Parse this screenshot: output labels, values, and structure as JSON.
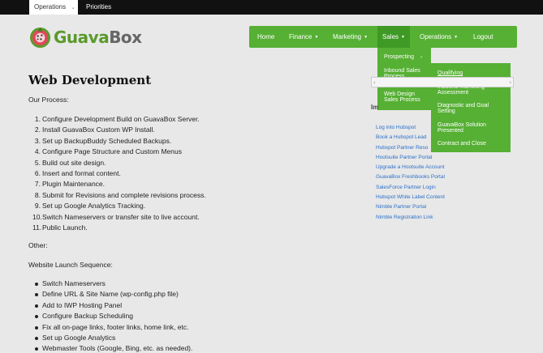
{
  "topbar": {
    "tabs": [
      {
        "label": "Operations"
      },
      {
        "label": "Priorities"
      }
    ]
  },
  "logo": {
    "part1": "Guava",
    "part2": "Box"
  },
  "nav": {
    "items": [
      "Home",
      "Finance",
      "Marketing",
      "Sales",
      "Operations",
      "Logout"
    ]
  },
  "sales_dropdown": {
    "items": [
      "Prospecting",
      "Inbound Sales Process Overview",
      "Web Design Sales Process"
    ]
  },
  "prospecting_submenu": {
    "items": [
      "Qualifying",
      "Inbound Marketing Assessment",
      "Diagnostic and Goal Setting",
      "GuavaBox Solution Presented",
      "Contract and Close"
    ]
  },
  "page": {
    "title": "Web Development",
    "our_process": "Our Process:",
    "steps": [
      "Configure Development Build on GuavaBox Server.",
      "Install GuavaBox Custom WP Install.",
      "Set up BackupBuddy Scheduled Backups.",
      "Configure Page Structure and Custom Menus",
      "Build out site design.",
      "Insert and format content.",
      "Plugin Maintenance.",
      "Submit for Revisions and complete revisions process.",
      "Set up Google Analytics Tracking.",
      "Switch Nameservers or transfer site to live account.",
      "Public Launch."
    ],
    "other": "Other:",
    "launch_heading": "Website Launch Sequence:",
    "launch_items": [
      "Switch Nameservers",
      "Define URL & Site Name (wp-config.php file)",
      "Add to IWP Hosting Panel",
      "Configure Backup Scheduling",
      "Fix all on-page links, footer links, home link, etc.",
      "Set up Google Analytics",
      "Webmaster Tools (Google, Bing, etc. as needed)."
    ]
  },
  "sidebar": {
    "heading": "Im",
    "links": [
      "Log into Hubspot",
      "Book a Hubspot Lead",
      "Hubspot Partner Reso",
      "Hootsuite Partner Portal",
      "Upgrade a Hootsuite Account",
      "GuavaBox Freshbooks Portal",
      "SalesForce Partner Login",
      "Hubspot White Label Content",
      "Nimble Partner Portal",
      "Nimble Registration Link"
    ]
  },
  "colors": {
    "accent": "#56b034",
    "link": "#2a6fc9"
  }
}
